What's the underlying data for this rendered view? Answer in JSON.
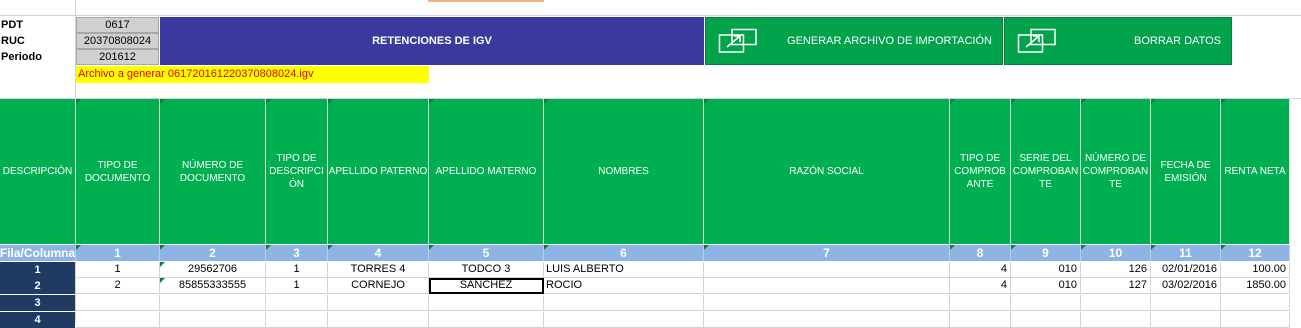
{
  "meta": {
    "pdt_label": "PDT",
    "pdt_value": "0617",
    "ruc_label": "RUC",
    "ruc_value": "20370808024",
    "periodo_label": "Periodo",
    "periodo_value": "201612",
    "filename": "Archivo a generar 0617201612203708080​24.igv"
  },
  "banner": {
    "title": "RETENCIONES DE IGV"
  },
  "buttons": {
    "generate_label": "GENERAR ARCHIVO DE IMPORTACIÓN",
    "clear_label": "BORRAR DATOS"
  },
  "headers": [
    "DESCRIPCIÓN",
    "TIPO DE\nDOCUMENTO",
    "NÚMERO DE\nDOCUMENTO",
    "TIPO DE\nDESCRIPCI\nÓN",
    "APELLIDO PATERNO",
    "APELLIDO MATERNO",
    "NOMBRES",
    "RAZÓN SOCIAL",
    "TIPO DE\nCOMPROB\nANTE",
    "SERIE DEL\nCOMPROBAN\nTE",
    "NÚMERO DE\nCOMPROBAN\nTE",
    "FECHA DE\nEMISIÓN",
    "RENTA NETA"
  ],
  "col_numbers": [
    "Fila/Columna",
    "1",
    "2",
    "3",
    "4",
    "5",
    "6",
    "7",
    "8",
    "9",
    "10",
    "11",
    "12"
  ],
  "rows": [
    {
      "no": "1",
      "cells": [
        "1",
        "29562706",
        "1",
        "TORRES 4",
        "TODCO 3",
        "LUIS ALBERTO",
        "",
        "4",
        "010",
        "126",
        "02/01/2016",
        "100.00"
      ]
    },
    {
      "no": "2",
      "cells": [
        "2",
        "85855333555",
        "1",
        "CORNEJO",
        "SANCHEZ",
        "ROCIO",
        "",
        "4",
        "010",
        "127",
        "03/02/2016",
        "1850.00"
      ]
    },
    {
      "no": "3",
      "cells": [
        "",
        "",
        "",
        "",
        "",
        "",
        "",
        "",
        "",
        "",
        "",
        ""
      ]
    },
    {
      "no": "4",
      "cells": [
        "",
        "",
        "",
        "",
        "",
        "",
        "",
        "",
        "",
        "",
        "",
        ""
      ]
    }
  ],
  "colors": {
    "header_green": "#00b050",
    "banner_blue": "#3a3a9e",
    "button_green": "#00a24b",
    "colnum_blue": "#8eb4e3",
    "rowno_navy": "#1f3b63"
  }
}
